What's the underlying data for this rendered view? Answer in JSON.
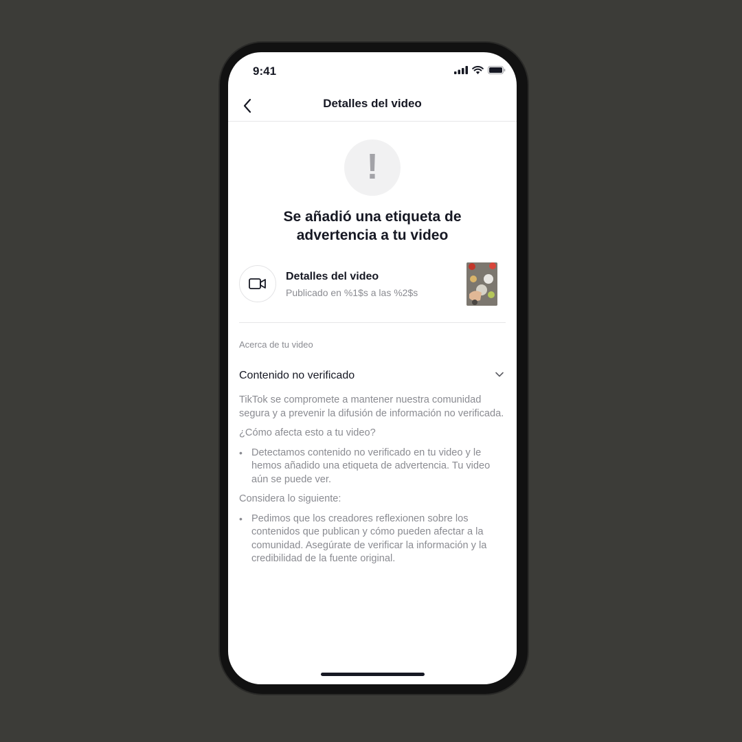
{
  "status": {
    "time": "9:41"
  },
  "nav": {
    "title": "Detalles del video"
  },
  "alert": {
    "mark": "!"
  },
  "headline": "Se añadió una etiqueta de advertencia a tu video",
  "video": {
    "title": "Detalles del video",
    "subtitle": "Publicado en %1$s a las %2$s"
  },
  "section_label": "Acerca de tu video",
  "accordion": {
    "title": "Contenido no verificado",
    "intro": "TikTok se compromete a mantener nuestra comunidad segura y a prevenir la difusión de información no verificada.",
    "question": "¿Cómo afecta esto a tu video?",
    "bullet_1": "Detectamos contenido no verificado en tu video y le hemos añadido una etiqueta de advertencia. Tu video aún se puede ver.",
    "consider": "Considera lo siguiente:",
    "bullet_2": "Pedimos que los creadores reflexionen sobre los contenidos que publican y cómo pueden afectar a la comunidad. Asegúrate de verificar la información y la credibilidad de la fuente original."
  },
  "bullet_glyph": "•"
}
